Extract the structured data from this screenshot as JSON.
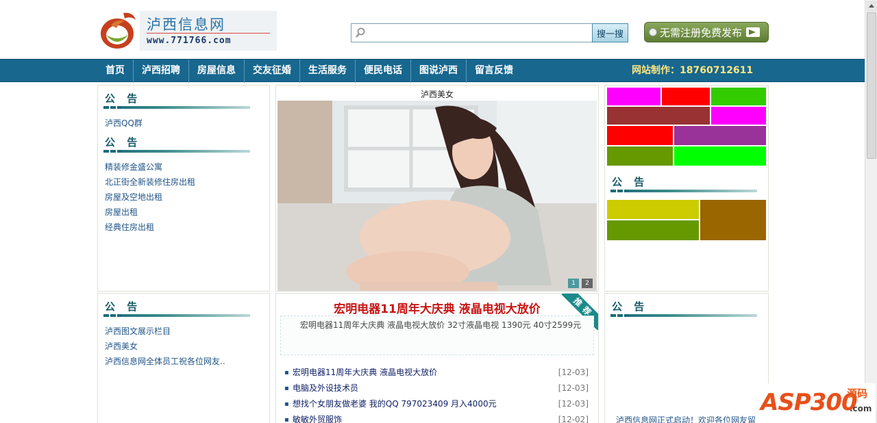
{
  "header": {
    "logo_title": "泸西信息网",
    "logo_url": "www.771766.com",
    "search": {
      "placeholder": "",
      "button_label": "搜一搜"
    },
    "post_button_label": "无需注册免费发布"
  },
  "nav": {
    "items": [
      {
        "label": "首页"
      },
      {
        "label": "泸西招聘"
      },
      {
        "label": "房屋信息"
      },
      {
        "label": "交友征婚"
      },
      {
        "label": "生活服务"
      },
      {
        "label": "便民电话"
      },
      {
        "label": "图说泸西"
      },
      {
        "label": "留言反馈"
      }
    ],
    "contact": "网站制作：18760712611"
  },
  "left_top": {
    "section1": {
      "title": "公 告",
      "items": [
        {
          "label": "泸西QQ群"
        }
      ]
    },
    "section2": {
      "title": "公 告",
      "items": [
        {
          "label": "精装修金盛公寓"
        },
        {
          "label": "北正街全新装修住房出租"
        },
        {
          "label": "房屋及空地出租"
        },
        {
          "label": "房屋出租"
        },
        {
          "label": "经典住房出租"
        }
      ]
    }
  },
  "slideshow": {
    "title": "泸西美女",
    "pages": [
      "1",
      "2"
    ]
  },
  "right_top": {
    "title": "公 告",
    "grid_colors": {
      "row1": [
        "#ff00ff",
        "#ff0000",
        "#33cc00"
      ],
      "row2": [
        "#993333",
        "#ff00ff"
      ],
      "row3": [
        "#ff0000",
        "#993399"
      ],
      "row4": [
        "#669900",
        "#00ff00"
      ],
      "row5": [
        "#cccc00",
        "#996600"
      ],
      "row6": [
        "#669900"
      ]
    }
  },
  "left_bottom": {
    "title": "公 告",
    "items": [
      {
        "label": "泸西图文展示栏目"
      },
      {
        "label": "泸西美女"
      },
      {
        "label": "泸西信息网全体员工祝各位网友.."
      }
    ]
  },
  "featured": {
    "title": "宏明电器11周年大庆典  液晶电视大放价",
    "ribbon": "推荐",
    "description": "宏明电器11周年大庆典 液晶电视大放价 32寸液晶电视 1390元 40寸2599元",
    "news": [
      {
        "text": "宏明电器11周年大庆典 液晶电视大放价",
        "date": "[12-03]"
      },
      {
        "text": "电脑及外设技术员",
        "date": "[12-03]"
      },
      {
        "text": "想找个女朋友做老婆 我的QQ 797023409 月入4000元",
        "date": "[12-03]"
      },
      {
        "text": "敏敏外贸服饰",
        "date": "[12-02]"
      }
    ]
  },
  "right_bottom": {
    "title": "公 告",
    "marquee": "泸西信息网正式启动！欢迎各位网友留"
  },
  "watermark": {
    "brand": "ASP300",
    "cn": "源码",
    "com": ".com"
  }
}
